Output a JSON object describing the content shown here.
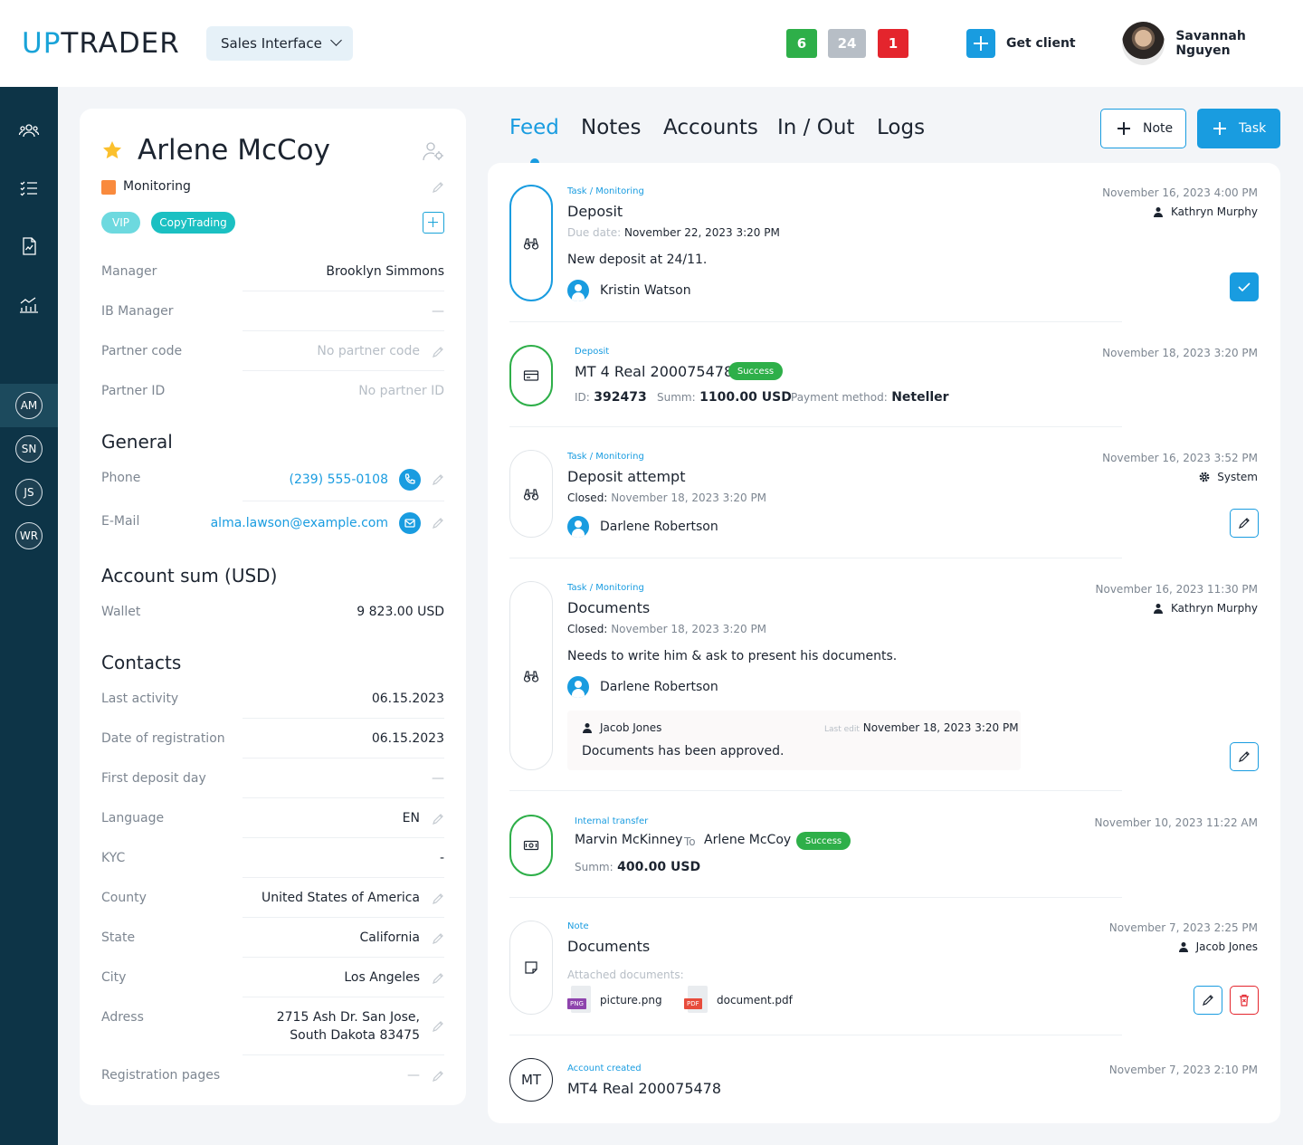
{
  "app": {
    "logo_up": "UP",
    "logo_rest": "TRADER",
    "interface": "Sales Interface",
    "counters": [
      "6",
      "24",
      "1"
    ],
    "get_client": "Get client",
    "user_name": "Savannah Nguyen"
  },
  "sidebar": {
    "icons": [
      "users-icon",
      "checklist-icon",
      "document-chart-icon",
      "analytics-icon"
    ],
    "avatars": [
      "AM",
      "SN",
      "JS",
      "WR"
    ]
  },
  "profile": {
    "name": "Arlene McCoy",
    "status": "Monitoring",
    "tags": [
      "VIP",
      "CopyTrading"
    ],
    "manager_label": "Manager",
    "manager_value": "Brooklyn Simmons",
    "ib_label": "IB Manager",
    "ib_value": "—",
    "partner_code_label": "Partner code",
    "partner_code_value": "No partner code",
    "partner_id_label": "Partner ID",
    "partner_id_value": "No partner ID",
    "general_title": "General",
    "phone_label": "Phone",
    "phone_value": "(239) 555-0108",
    "email_label": "E-Mail",
    "email_value": "alma.lawson@example.com",
    "account_title": "Account sum (USD)",
    "wallet_label": "Wallet",
    "wallet_value": "9 823.00 USD",
    "contacts_title": "Contacts",
    "last_activity_label": "Last activity",
    "last_activity_value": "06.15.2023",
    "reg_date_label": "Date of registration",
    "reg_date_value": "06.15.2023",
    "first_deposit_label": "First deposit day",
    "first_deposit_value": "—",
    "language_label": "Language",
    "language_value": "EN",
    "kyc_label": "KYC",
    "kyc_value": "-",
    "county_label": "County",
    "county_value": "United States of America",
    "state_label": "State",
    "state_value": "California",
    "city_label": "City",
    "city_value": "Los Angeles",
    "address_label": "Adress",
    "address_line1": "2715 Ash Dr. San Jose,",
    "address_line2": "South Dakota 83475",
    "reg_pages_label": "Registration pages",
    "reg_pages_value": "—"
  },
  "tabs": {
    "feed": "Feed",
    "notes": "Notes",
    "accounts": "Accounts",
    "inout": "In / Out",
    "logs": "Logs",
    "note_btn": "Note",
    "task_btn": "Task"
  },
  "feed": {
    "item1": {
      "category": "Task / Monitoring",
      "title": "Deposit",
      "due_label": "Due date:",
      "due_value": "November 22, 2023 3:20 PM",
      "text": "New deposit at 24/11.",
      "person": "Kristin Watson",
      "date": "November 16, 2023 4:00 PM",
      "author": "Kathryn Murphy"
    },
    "item2": {
      "category": "Deposit",
      "title": "MT 4 Real 200075478",
      "status": "Success",
      "id_label": "ID:",
      "id_value": "392473",
      "sum_label": "Summ:",
      "sum_value": "1100.00 USD",
      "method_label": "Payment method:",
      "method_value": "Neteller",
      "date": "November 18, 2023 3:20 PM"
    },
    "item3": {
      "category": "Task / Monitoring",
      "title": "Deposit attempt",
      "closed_label": "Closed:",
      "closed_value": "November 18, 2023 3:20 PM",
      "person": "Darlene Robertson",
      "date": "November 16, 2023 3:52 PM",
      "author": "System"
    },
    "item4": {
      "category": "Task / Monitoring",
      "title": "Documents",
      "closed_label": "Closed:",
      "closed_value": "November 18, 2023 3:20 PM",
      "text": "Needs to write him & ask to present his documents.",
      "person": "Darlene Robertson",
      "date": "November 16, 2023 11:30 PM",
      "author": "Kathryn Murphy",
      "comment_author": "Jacob Jones",
      "comment_edit_label": "Last edit",
      "comment_edit_value": "November 18, 2023 3:20 PM",
      "comment_text": "Documents has been approved."
    },
    "item5": {
      "category": "Internal transfer",
      "from": "Marvin McKinney",
      "to_label": "To",
      "to": "Arlene McCoy",
      "status": "Success",
      "sum_label": "Summ:",
      "sum_value": "400.00 USD",
      "date": "November 10, 2023 11:22 AM"
    },
    "item6": {
      "category": "Note",
      "title": "Documents",
      "attached_label": "Attached documents:",
      "files": [
        {
          "ext": "PNG",
          "name": "picture.png"
        },
        {
          "ext": "PDF",
          "name": "document.pdf"
        }
      ],
      "date": "November 7, 2023 2:25 PM",
      "author": "Jacob Jones"
    },
    "item7": {
      "badge": "MT",
      "category": "Account created",
      "title": "MT4 Real 200075478",
      "date": "November 7, 2023 2:10 PM"
    }
  }
}
